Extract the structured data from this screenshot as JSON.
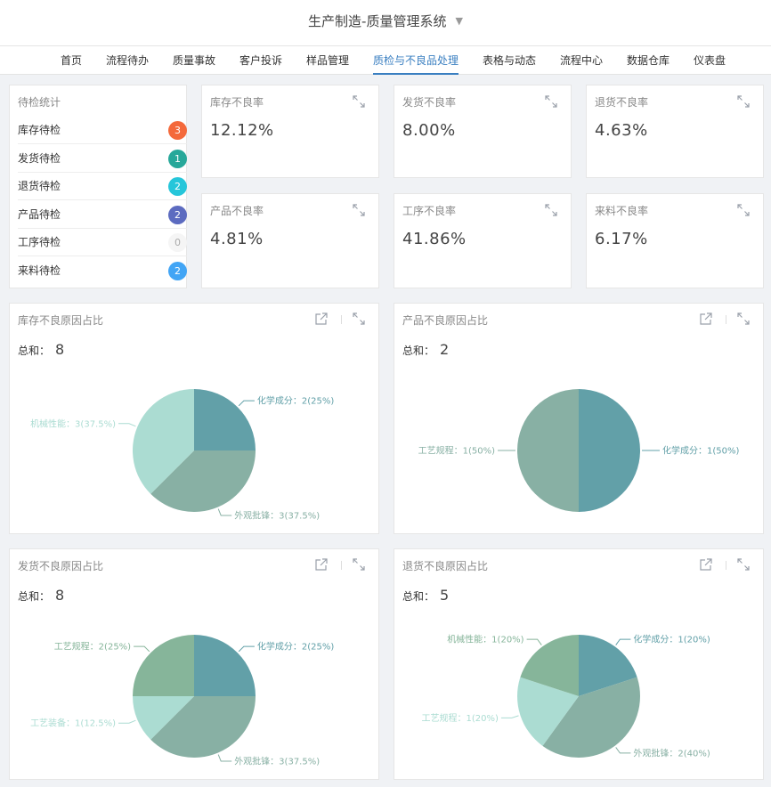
{
  "app": {
    "title": "生产制造-质量管理系统"
  },
  "nav": [
    "首页",
    "流程待办",
    "质量事故",
    "客户投诉",
    "样品管理",
    "质检与不良品处理",
    "表格与动态",
    "流程中心",
    "数据仓库",
    "仪表盘"
  ],
  "nav_active": 5,
  "pending": {
    "title": "待检统计",
    "items": [
      {
        "label": "库存待检",
        "count": "3",
        "color": "#f4693b"
      },
      {
        "label": "发货待检",
        "count": "1",
        "color": "#27a89a"
      },
      {
        "label": "退货待检",
        "count": "2",
        "color": "#26c6da"
      },
      {
        "label": "产品待检",
        "count": "2",
        "color": "#5c6bc0"
      },
      {
        "label": "工序待检",
        "count": "0",
        "color": "#f5f5f5"
      },
      {
        "label": "来料待检",
        "count": "2",
        "color": "#42a5f5"
      }
    ]
  },
  "metrics": [
    {
      "title": "库存不良率",
      "value": "12.12%"
    },
    {
      "title": "发货不良率",
      "value": "8.00%"
    },
    {
      "title": "退货不良率",
      "value": "4.63%"
    },
    {
      "title": "产品不良率",
      "value": "4.81%"
    },
    {
      "title": "工序不良率",
      "value": "41.86%"
    },
    {
      "title": "来料不良率",
      "value": "6.17%"
    }
  ],
  "sum_label": "总和：",
  "colors": {
    "chemical": "#62a0a8",
    "appearance": "#88b0a4",
    "mechanical": "#abdcd2",
    "process": "#86b59a",
    "equipment": "#abdcd2",
    "accent": "#3a7fc1"
  },
  "chart_data": [
    {
      "type": "pie",
      "title": "库存不良原因占比",
      "total": "8",
      "slices": [
        {
          "label": "化学成分：2(25%)",
          "value": 2,
          "color": "#62a0a8"
        },
        {
          "label": "外观批锋：3(37.5%)",
          "value": 3,
          "color": "#88b0a4"
        },
        {
          "label": "机械性能：3(37.5%)",
          "value": 3,
          "color": "#abdcd2"
        }
      ]
    },
    {
      "type": "pie",
      "title": "产品不良原因占比",
      "total": "2",
      "slices": [
        {
          "label": "化学成分：1(50%)",
          "value": 1,
          "color": "#62a0a8"
        },
        {
          "label": "工艺规程：1(50%)",
          "value": 1,
          "color": "#88b0a4"
        }
      ]
    },
    {
      "type": "pie",
      "title": "发货不良原因占比",
      "total": "8",
      "slices": [
        {
          "label": "化学成分：2(25%)",
          "value": 2,
          "color": "#62a0a8"
        },
        {
          "label": "外观批锋：3(37.5%)",
          "value": 3,
          "color": "#88b0a4"
        },
        {
          "label": "工艺装备：1(12.5%)",
          "value": 1,
          "color": "#abdcd2"
        },
        {
          "label": "工艺规程：2(25%)",
          "value": 2,
          "color": "#86b59a"
        }
      ]
    },
    {
      "type": "pie",
      "title": "退货不良原因占比",
      "total": "5",
      "slices": [
        {
          "label": "化学成分：1(20%)",
          "value": 1,
          "color": "#62a0a8"
        },
        {
          "label": "外观批锋：2(40%)",
          "value": 2,
          "color": "#88b0a4"
        },
        {
          "label": "工艺规程：1(20%)",
          "value": 1,
          "color": "#abdcd2"
        },
        {
          "label": "机械性能：1(20%)",
          "value": 1,
          "color": "#86b59a"
        }
      ]
    }
  ]
}
